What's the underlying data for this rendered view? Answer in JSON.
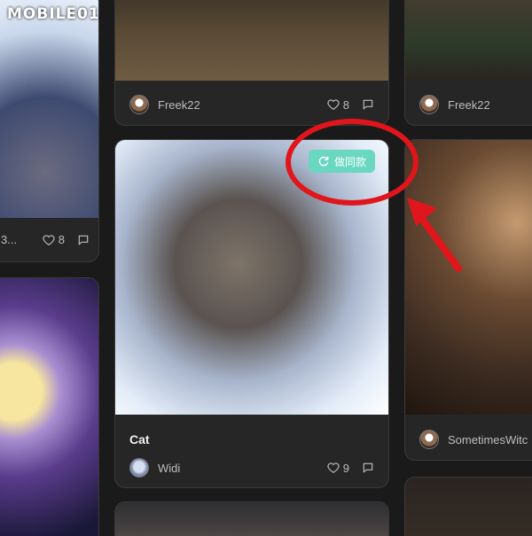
{
  "watermark": {
    "logo_text": "MOBILE01"
  },
  "cards": [
    {
      "id": "top-left",
      "stats": {
        "name": "3...",
        "likes": "8"
      }
    },
    {
      "id": "wagon",
      "author": "Freek22",
      "likes": "8"
    },
    {
      "id": "owl",
      "author": "Freek22"
    },
    {
      "id": "kitten",
      "title": "Cat",
      "author": "Widi",
      "likes": "9",
      "badge": "做同款"
    },
    {
      "id": "cup-cat",
      "author": "SometimesWitc"
    }
  ],
  "colors": {
    "badge": "#6ad7c0",
    "annotation": "#e0161c",
    "card_bg": "#262626",
    "page_bg": "#1a1a1a"
  },
  "icons": {
    "like": "heart-icon",
    "comment": "comment-icon",
    "remix": "refresh-icon"
  }
}
